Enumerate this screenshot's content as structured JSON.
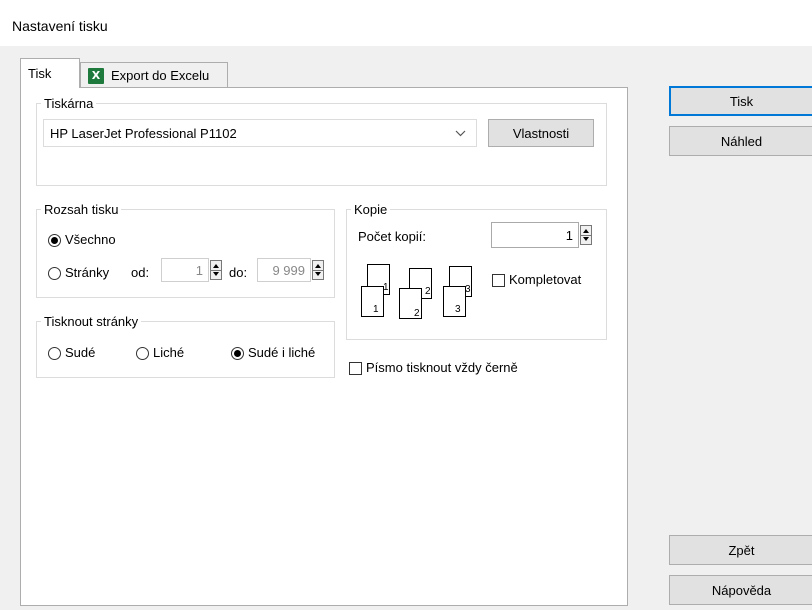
{
  "window": {
    "title": "Nastavení tisku"
  },
  "tabs": [
    {
      "label": "Tisk",
      "active": true
    },
    {
      "label": "Export do Excelu",
      "icon": "excel-icon",
      "icon_text": "X"
    }
  ],
  "printer": {
    "group_label": "Tiskárna",
    "selected": "HP LaserJet Professional P1102",
    "properties_button": "Vlastnosti"
  },
  "range": {
    "group_label": "Rozsah tisku",
    "all_label": "Všechno",
    "pages_label": "Stránky",
    "from_label": "od:",
    "from_value": "1",
    "to_label": "do:",
    "to_value": "9 999",
    "selected": "all"
  },
  "print_pages": {
    "group_label": "Tisknout stránky",
    "even_label": "Sudé",
    "odd_label": "Liché",
    "both_label": "Sudé i liché",
    "selected": "both"
  },
  "copies": {
    "group_label": "Kopie",
    "count_label": "Počet kopií:",
    "count_value": "1",
    "collate_label": "Kompletovat",
    "collate_checked": false,
    "page_numbers": [
      "1",
      "1",
      "2",
      "2",
      "3",
      "3"
    ]
  },
  "black_text": {
    "label": "Písmo tisknout vždy černě",
    "checked": false
  },
  "buttons": {
    "print": "Tisk",
    "preview": "Náhled",
    "back": "Zpět",
    "help": "Nápověda"
  },
  "colors": {
    "accent": "#0078d7",
    "excel": "#1d7a3c"
  }
}
